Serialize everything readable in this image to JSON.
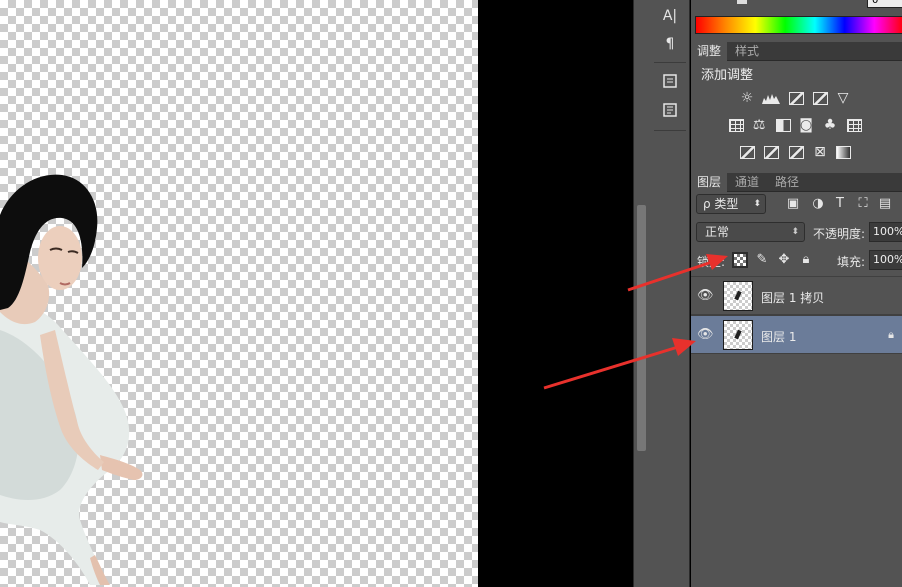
{
  "toolstrip": {
    "type_tool_glyph": "A|",
    "paragraph_glyph": "¶"
  },
  "color": {
    "value_field": "0"
  },
  "adjustments": {
    "tabs": [
      "调整",
      "样式"
    ],
    "title": "添加调整",
    "icons_row1": [
      "brightness-icon",
      "levels-icon",
      "curves-icon",
      "exposure-icon",
      "vibrance-icon"
    ],
    "icons_row2": [
      "hue-saturation-icon",
      "color-balance-icon",
      "black-white-icon",
      "photo-filter-icon",
      "channel-mixer-icon",
      "color-lookup-icon"
    ],
    "icons_row3": [
      "invert-icon",
      "posterize-icon",
      "threshold-icon",
      "selective-color-icon",
      "gradient-map-icon"
    ]
  },
  "layers": {
    "tabs": [
      "图层",
      "通道",
      "路径"
    ],
    "filter_label": "ρ 类型",
    "blend_mode": "正常",
    "opacity_label": "不透明度:",
    "opacity_value": "100%",
    "lock_label": "锁定:",
    "fill_label": "填充:",
    "fill_value": "100%",
    "items": [
      {
        "name": "图层 1 拷贝",
        "selected": false,
        "locked": false
      },
      {
        "name": "图层 1",
        "selected": true,
        "locked": true
      }
    ]
  },
  "colors": {
    "panel_bg": "#535353",
    "selected_row": "#6b7c99",
    "annotation_arrow": "#e8312c"
  }
}
